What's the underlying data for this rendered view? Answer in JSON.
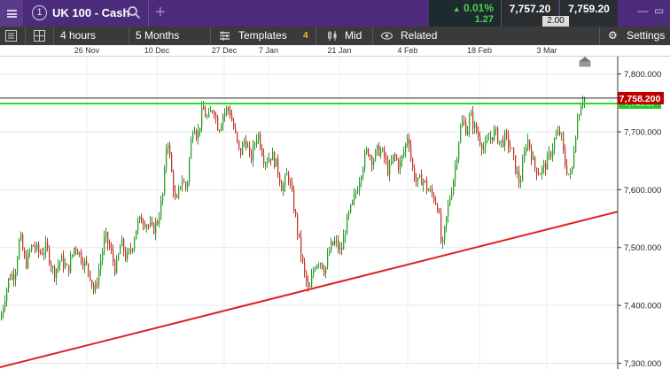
{
  "topbar": {
    "tab_number": "1",
    "instrument": "UK 100 - Cash",
    "change_pct": "0.01%",
    "change_abs": "1.27",
    "sell_price": "7,757.20",
    "buy_price": "7,759.20",
    "spread": "2.00",
    "colors": {
      "brand": "#4c2c7a",
      "up": "#4fd04f"
    }
  },
  "toolbar": {
    "interval": "4 hours",
    "range": "5 Months",
    "templates_label": "Templates",
    "templates_count": "4",
    "price_type": "Mid",
    "related_label": "Related",
    "settings_label": "Settings"
  },
  "chart_data": {
    "type": "candlestick",
    "x_ticks": [
      "26 Nov",
      "10 Dec",
      "27 Dec",
      "7 Jan",
      "21 Jan",
      "4 Feb",
      "18 Feb",
      "3 Mar"
    ],
    "y_ticks": [
      "7,800.000",
      "7,700.000",
      "7,600.000",
      "7,500.000",
      "7,400.000",
      "7,300.000"
    ],
    "ylim": [
      7290,
      7830
    ],
    "current_price_label": "7,758.200",
    "current_price": 7758.2,
    "green_line_label": "7,749.07",
    "green_line_value": 7749,
    "horizontal_line_value": 7758.2,
    "trendline": {
      "start": 7293,
      "end": 7562
    },
    "colors": {
      "up": "#2a9d2a",
      "down": "#c0392b",
      "trend": "#e02020",
      "level": "#00cc00",
      "price_tag": "#c00000"
    },
    "close_path": [
      [
        0,
        7375
      ],
      [
        4,
        7410
      ],
      [
        10,
        7450
      ],
      [
        16,
        7455
      ],
      [
        22,
        7520
      ],
      [
        28,
        7470
      ],
      [
        36,
        7505
      ],
      [
        44,
        7490
      ],
      [
        52,
        7500
      ],
      [
        60,
        7455
      ],
      [
        68,
        7480
      ],
      [
        76,
        7460
      ],
      [
        84,
        7505
      ],
      [
        92,
        7480
      ],
      [
        100,
        7460
      ],
      [
        106,
        7420
      ],
      [
        112,
        7470
      ],
      [
        118,
        7520
      ],
      [
        124,
        7495
      ],
      [
        130,
        7460
      ],
      [
        136,
        7510
      ],
      [
        142,
        7480
      ],
      [
        148,
        7500
      ],
      [
        154,
        7540
      ],
      [
        160,
        7550
      ],
      [
        166,
        7540
      ],
      [
        172,
        7530
      ],
      [
        178,
        7550
      ],
      [
        184,
        7600
      ],
      [
        188,
        7700
      ],
      [
        192,
        7640
      ],
      [
        198,
        7570
      ],
      [
        204,
        7620
      ],
      [
        210,
        7600
      ],
      [
        214,
        7670
      ],
      [
        218,
        7720
      ],
      [
        222,
        7690
      ],
      [
        228,
        7740
      ],
      [
        234,
        7720
      ],
      [
        240,
        7745
      ],
      [
        246,
        7705
      ],
      [
        252,
        7735
      ],
      [
        258,
        7740
      ],
      [
        264,
        7700
      ],
      [
        270,
        7660
      ],
      [
        276,
        7690
      ],
      [
        282,
        7650
      ],
      [
        290,
        7700
      ],
      [
        298,
        7650
      ],
      [
        306,
        7660
      ],
      [
        312,
        7640
      ],
      [
        318,
        7600
      ],
      [
        324,
        7630
      ],
      [
        330,
        7580
      ],
      [
        336,
        7520
      ],
      [
        342,
        7460
      ],
      [
        348,
        7420
      ],
      [
        354,
        7470
      ],
      [
        360,
        7480
      ],
      [
        366,
        7460
      ],
      [
        372,
        7500
      ],
      [
        378,
        7510
      ],
      [
        384,
        7490
      ],
      [
        390,
        7540
      ],
      [
        396,
        7570
      ],
      [
        402,
        7600
      ],
      [
        408,
        7640
      ],
      [
        414,
        7670
      ],
      [
        420,
        7650
      ],
      [
        426,
        7670
      ],
      [
        432,
        7660
      ],
      [
        438,
        7630
      ],
      [
        444,
        7660
      ],
      [
        450,
        7640
      ],
      [
        456,
        7670
      ],
      [
        460,
        7700
      ],
      [
        464,
        7640
      ],
      [
        470,
        7610
      ],
      [
        476,
        7620
      ],
      [
        482,
        7600
      ],
      [
        488,
        7590
      ],
      [
        494,
        7570
      ],
      [
        498,
        7490
      ],
      [
        502,
        7540
      ],
      [
        506,
        7580
      ],
      [
        510,
        7610
      ],
      [
        514,
        7650
      ],
      [
        518,
        7700
      ],
      [
        522,
        7720
      ],
      [
        526,
        7700
      ],
      [
        530,
        7730
      ],
      [
        534,
        7710
      ],
      [
        540,
        7690
      ],
      [
        546,
        7670
      ],
      [
        552,
        7690
      ],
      [
        558,
        7700
      ],
      [
        564,
        7680
      ],
      [
        570,
        7690
      ],
      [
        576,
        7670
      ],
      [
        582,
        7630
      ],
      [
        586,
        7610
      ],
      [
        590,
        7650
      ],
      [
        594,
        7690
      ],
      [
        598,
        7670
      ],
      [
        602,
        7640
      ],
      [
        608,
        7630
      ],
      [
        614,
        7640
      ],
      [
        620,
        7660
      ],
      [
        626,
        7690
      ],
      [
        632,
        7700
      ],
      [
        636,
        7650
      ],
      [
        640,
        7630
      ],
      [
        644,
        7620
      ],
      [
        648,
        7690
      ],
      [
        652,
        7730
      ],
      [
        656,
        7760
      ],
      [
        659,
        7758
      ]
    ]
  }
}
